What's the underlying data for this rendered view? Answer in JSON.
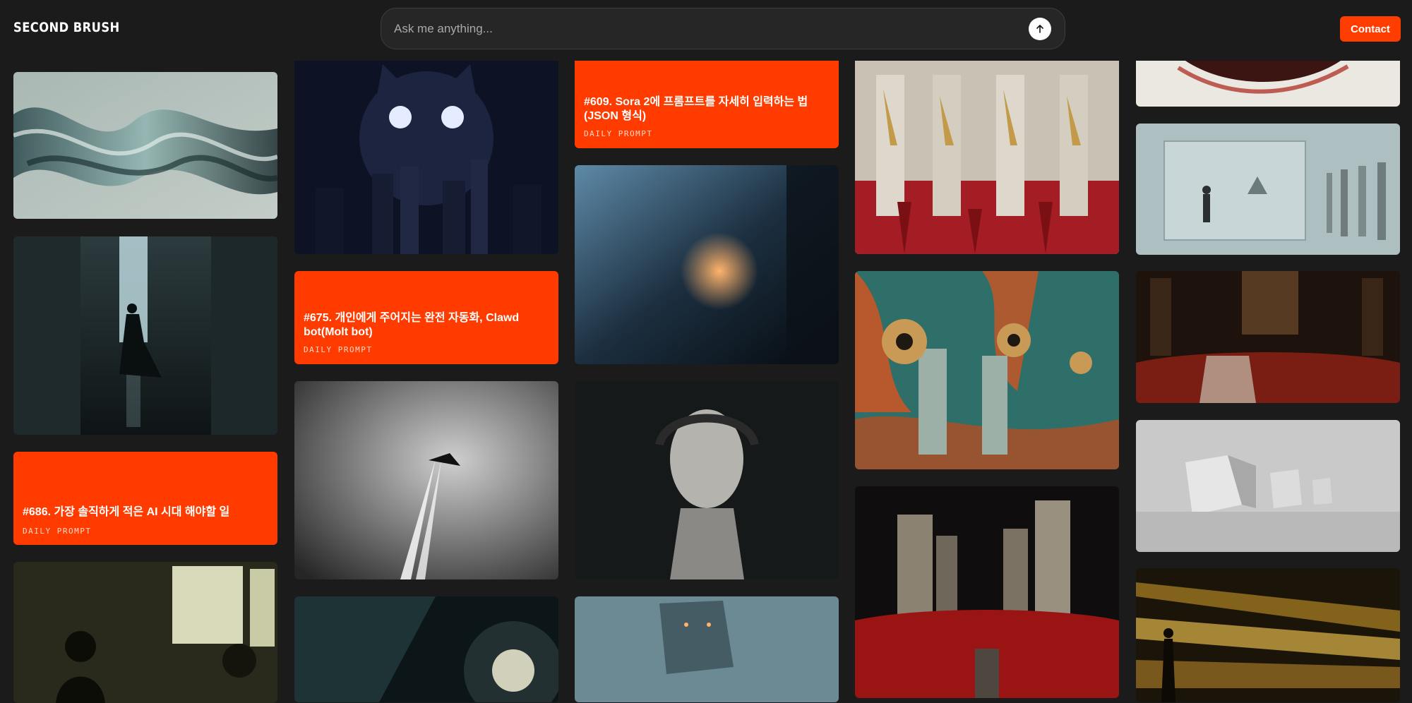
{
  "header": {
    "logo": "SECOND BRUSH",
    "search_placeholder": "Ask me anything...",
    "contact_label": "Contact"
  },
  "cards": {
    "c686": {
      "title": "#686. 가장 솔직하게 적은 AI 시대 해야할 일",
      "tag": "DAILY PROMPT"
    },
    "c675": {
      "title": "#675. 개인에게 주어지는 완전 자동화, Clawd bot(Molt bot)",
      "tag": "DAILY PROMPT"
    },
    "c609": {
      "title": "#609. Sora 2에 프롬프트를 자세히 입력하는 법 (JSON 형식)",
      "tag": "DAILY PROMPT"
    }
  },
  "colors": {
    "accent": "#ff3b00",
    "background": "#1b1b1b"
  },
  "icons": {
    "send": "arrow-up-icon"
  }
}
